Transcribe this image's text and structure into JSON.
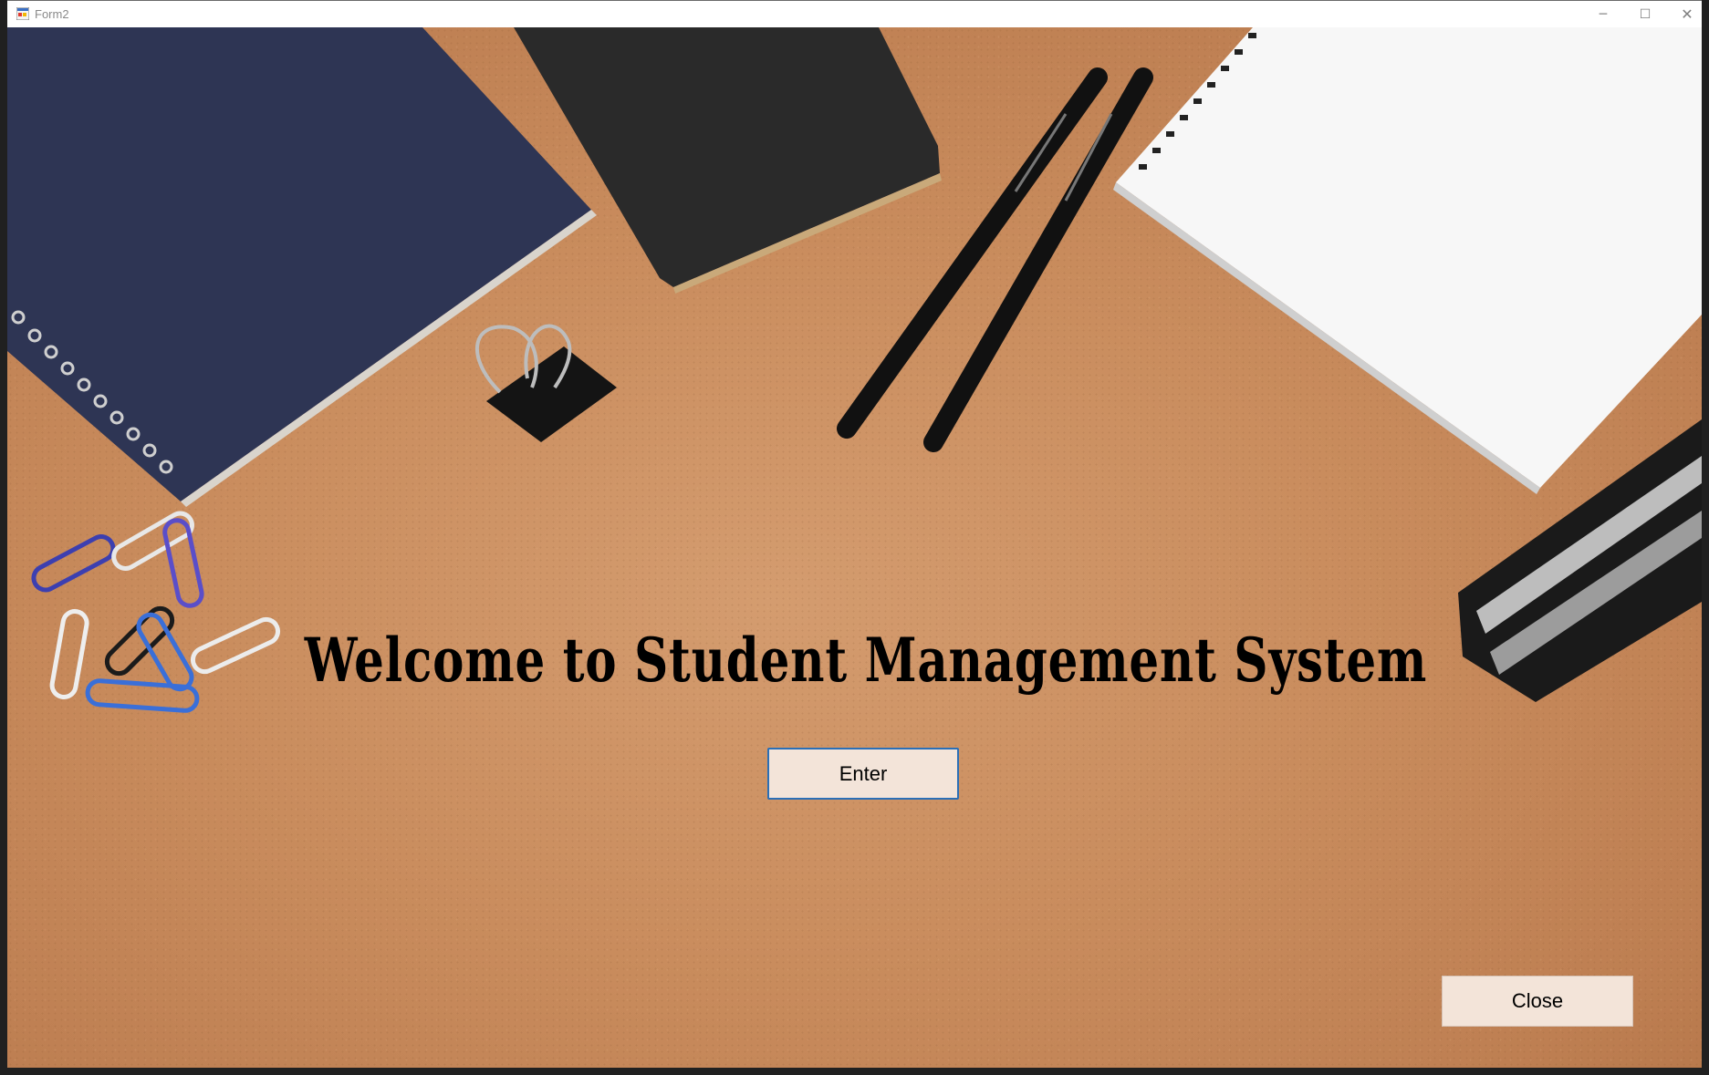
{
  "window": {
    "title": "Form2",
    "minimize_glyph": "─",
    "maximize_glyph": "☐",
    "close_glyph": "✕"
  },
  "main": {
    "heading": "Welcome to Student Management System",
    "enter_label": "Enter",
    "close_label": "Close"
  },
  "background": {
    "desk_color": "#c98c5d",
    "items": [
      "blue-notebook",
      "black-notebook",
      "binder-clip",
      "pens",
      "white-spiral-notepad",
      "stapler",
      "paper-clips"
    ]
  }
}
